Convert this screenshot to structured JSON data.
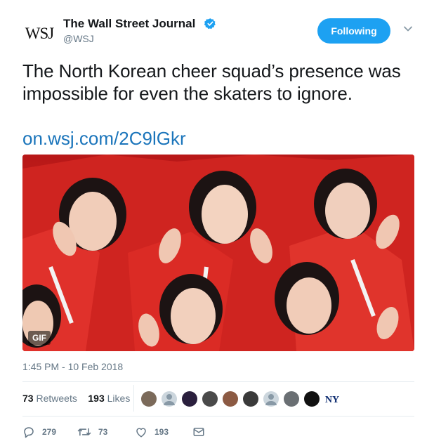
{
  "header": {
    "avatar_text": "WSJ",
    "display_name": "The Wall Street Journal",
    "handle": "@WSJ",
    "follow_label": "Following",
    "verified_icon": "verified-badge-icon",
    "menu_icon": "chevron-down-icon"
  },
  "tweet": {
    "text": "The North Korean cheer squad’s presence was impossible for even the skaters to ignore.",
    "link": "on.wsj.com/2C9lGkr"
  },
  "media": {
    "badge": "GIF",
    "description_colors": {
      "uniform": "#d6211f",
      "skin": "#f1cdb9",
      "hair": "#1c1313"
    }
  },
  "timestamp": "1:45 PM - 10 Feb 2018",
  "stats": {
    "retweets_count": "73",
    "retweets_label": "Retweets",
    "likes_count": "193",
    "likes_label": "Likes"
  },
  "actions": {
    "reply_count": "279",
    "retweet_count": "73",
    "like_count": "193"
  },
  "colors": {
    "accent": "#1da1f2",
    "link": "#1b75bb",
    "muted": "#657786"
  }
}
